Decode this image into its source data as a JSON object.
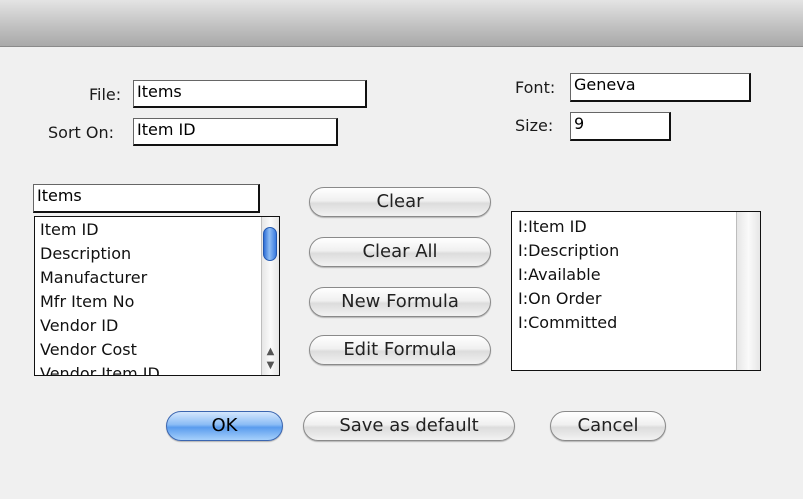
{
  "form": {
    "file_label": "File:",
    "file_value": "Items",
    "sort_label": "Sort On:",
    "sort_value": "Item ID",
    "font_label": "Font:",
    "font_value": "Geneva",
    "size_label": "Size:",
    "size_value": "9"
  },
  "left_list": {
    "filter_value": "Items",
    "items": [
      "Item ID",
      "Description",
      "Manufacturer",
      "Mfr Item No",
      "Vendor ID",
      "Vendor Cost",
      "Vendor Item ID"
    ]
  },
  "right_list": {
    "items": [
      "I:Item ID",
      "I:Description",
      "I:Available",
      "I:On Order",
      "I:Committed"
    ]
  },
  "buttons": {
    "clear": "Clear",
    "clear_all": "Clear All",
    "new_formula": "New Formula",
    "edit_formula": "Edit Formula",
    "ok": "OK",
    "save_default": "Save as default",
    "cancel": "Cancel"
  },
  "colors": {
    "accent": "#5a9cee",
    "scroll_thumb": "#3a7ae0"
  }
}
